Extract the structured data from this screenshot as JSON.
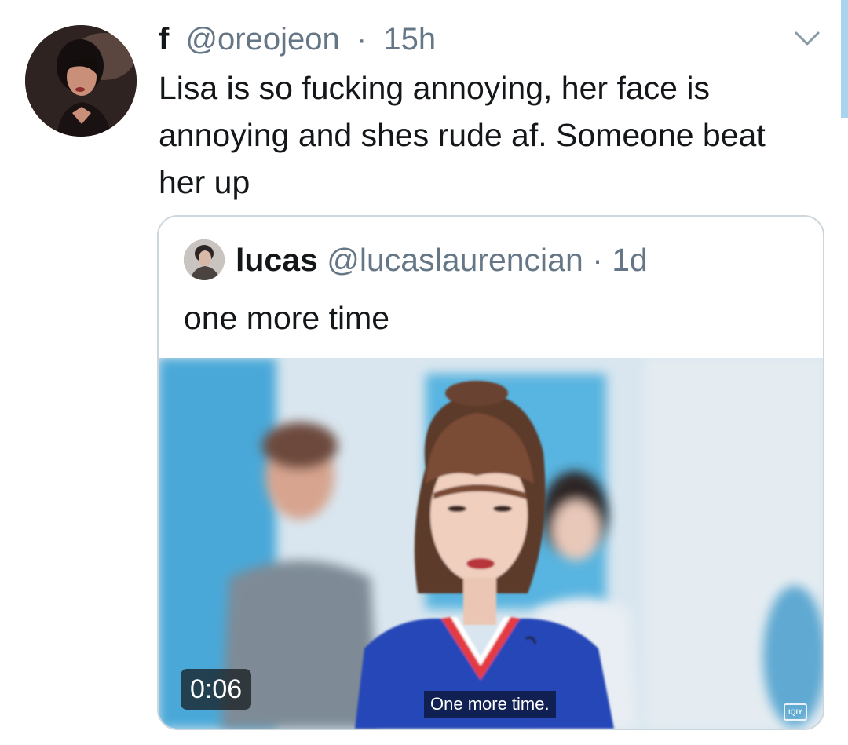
{
  "tweet": {
    "display_name": "f",
    "handle": "@oreojeon",
    "separator": "·",
    "time": "15h",
    "text": "Lisa is so fucking annoying, her face is annoying and shes rude af. Someone beat her up",
    "avatar_icon": "profile-photo",
    "menu_icon": "chevron-down-icon"
  },
  "quoted_tweet": {
    "display_name": "lucas",
    "handle": "@lucaslaurencian",
    "separator": "·",
    "time": "1d",
    "text": "one more time",
    "avatar_icon": "profile-photo",
    "media": {
      "type": "video",
      "duration": "0:06",
      "subtitle": "One more time.",
      "watermark": "iQIY"
    }
  },
  "colors": {
    "text_primary": "#14171a",
    "text_secondary": "#657786",
    "border": "#ccd6dd",
    "scroll_accent": "#a9d4f0"
  }
}
